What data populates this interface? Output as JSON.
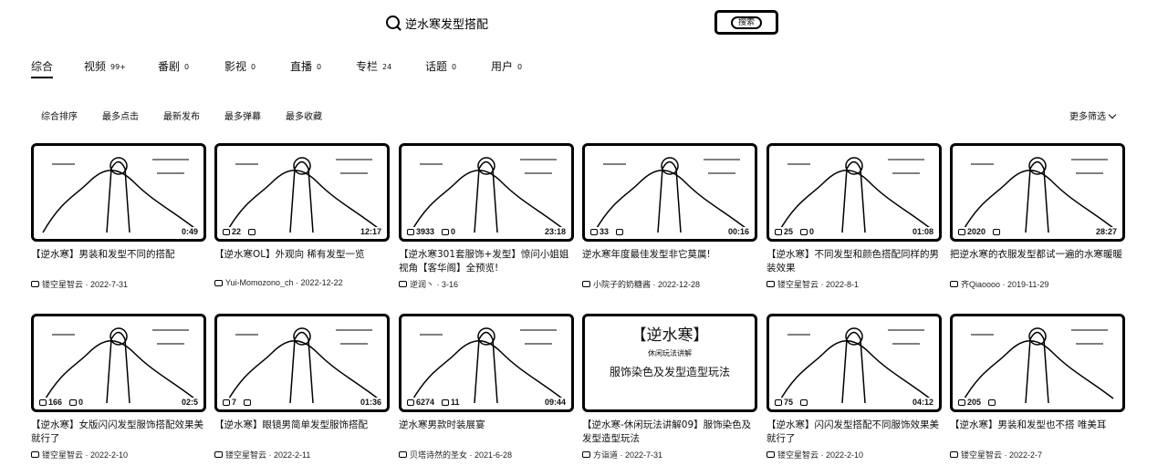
{
  "search": {
    "query": "逆水寒发型搭配",
    "button_label": "搜索"
  },
  "tabs": [
    {
      "label": "综合",
      "count": ""
    },
    {
      "label": "视频",
      "count": "99+"
    },
    {
      "label": "番剧",
      "count": "0"
    },
    {
      "label": "影视",
      "count": "0"
    },
    {
      "label": "直播",
      "count": "0"
    },
    {
      "label": "专栏",
      "count": "24"
    },
    {
      "label": "话题",
      "count": "0"
    },
    {
      "label": "用户",
      "count": "0"
    }
  ],
  "filters": [
    "综合排序",
    "最多点击",
    "最新发布",
    "最多弹幕",
    "最多收藏"
  ],
  "more_filters": "更多筛选",
  "videos": [
    {
      "title": "【逆水寒】男装和发型不同的搭配",
      "author": "镂空星智云",
      "date": "2022-7-31",
      "plays": "",
      "danmaku": "",
      "duration": "0:49"
    },
    {
      "title": "【逆水寒OL】外观向 稀有发型一览",
      "author": "Yui-Momozono_ch",
      "date": "2022-12-22",
      "plays": "22",
      "danmaku": "",
      "duration": "12:17"
    },
    {
      "title": "【逆水寒301套服饰+发型】惊问小姐姐视角【客华阁】全预览!",
      "author": "逆润丶",
      "date": "3-16",
      "plays": "3933",
      "danmaku": "0",
      "duration": "23:18"
    },
    {
      "title": "逆水寒年度最佳发型非它莫属!",
      "author": "小院子的奶糖酱",
      "date": "2022-12-28",
      "plays": "33",
      "danmaku": "",
      "duration": "00:16"
    },
    {
      "title": "【逆水寒】不同发型和颜色搭配同样的男装效果",
      "author": "镂空星智云",
      "date": "2022-8-1",
      "plays": "25",
      "danmaku": "0",
      "duration": "01:08"
    },
    {
      "title": "把逆水寒的衣服发型都试一遍的水寒暖暖",
      "author": "齐Qiaoooo",
      "date": "2019-11-29",
      "plays": "2020",
      "danmaku": "",
      "duration": "28:27"
    },
    {
      "title": "【逆水寒】女版闪闪发型服饰搭配效果美就行了",
      "author": "镂空星智云",
      "date": "2022-2-10",
      "plays": "166",
      "danmaku": "0",
      "duration": "02:5"
    },
    {
      "title": "【逆水寒】眼镜男简单发型服饰搭配",
      "author": "镂空星智云",
      "date": "2022-2-11",
      "plays": "7",
      "danmaku": "",
      "duration": "01:36"
    },
    {
      "title": "逆水寒男款时装展宴",
      "author": "贝塔诗然的圣女",
      "date": "2021-6-28",
      "plays": "6274",
      "danmaku": "11",
      "duration": "09:44"
    },
    {
      "title": "【逆水寒-休闲玩法讲解09】服饰染色及发型造型玩法",
      "author": "方诣道",
      "date": "2022-7-31",
      "plays": "",
      "danmaku": "",
      "duration": ""
    },
    {
      "title": "【逆水寒】闪闪发型搭配不同服饰效果美就行了",
      "author": "镂空星智云",
      "date": "2022-2-10",
      "plays": "75",
      "danmaku": "",
      "duration": "04:12"
    },
    {
      "title": "【逆水寒】男装和发型也不搭 唯美耳",
      "author": "镂空星智云",
      "date": "2022-2-7",
      "plays": "205",
      "danmaku": "",
      "duration": ""
    }
  ],
  "thumb_text": {
    "line1": "【逆水寒】",
    "line2": "休闲玩法讲解",
    "line3": "服饰染色及发型造型玩法"
  }
}
